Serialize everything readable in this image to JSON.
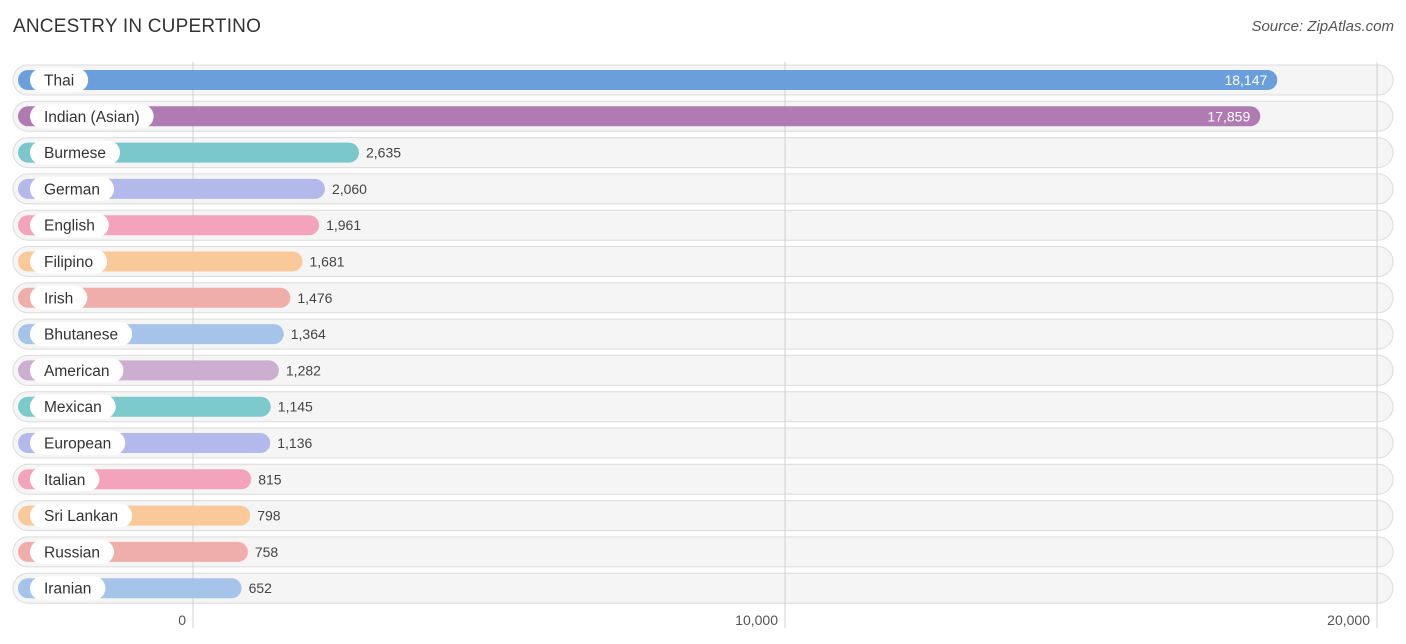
{
  "header": {
    "title": "ANCESTRY IN CUPERTINO",
    "source": "Source: ZipAtlas.com"
  },
  "chart_data": {
    "type": "bar",
    "orientation": "horizontal",
    "title": "ANCESTRY IN CUPERTINO",
    "xlabel": "",
    "ylabel": "",
    "xlim": [
      0,
      20000
    ],
    "x_ticks": [
      0,
      10000,
      20000
    ],
    "x_tick_labels": [
      "0",
      "10,000",
      "20,000"
    ],
    "grid": true,
    "categories": [
      "Thai",
      "Indian (Asian)",
      "Burmese",
      "German",
      "English",
      "Filipino",
      "Irish",
      "Bhutanese",
      "American",
      "Mexican",
      "European",
      "Italian",
      "Sri Lankan",
      "Russian",
      "Iranian"
    ],
    "values": [
      18147,
      17859,
      2635,
      2060,
      1961,
      1681,
      1476,
      1364,
      1282,
      1145,
      1136,
      815,
      798,
      758,
      652
    ],
    "value_labels": [
      "18,147",
      "17,859",
      "2,635",
      "2,060",
      "1,961",
      "1,681",
      "1,476",
      "1,364",
      "1,282",
      "1,145",
      "1,136",
      "815",
      "798",
      "758",
      "652"
    ],
    "colors": [
      "#6a9fdc",
      "#b07ab3",
      "#7ac8cc",
      "#b3b9ea",
      "#f4a3bd",
      "#f9c99a",
      "#efaeaa",
      "#a6c4ea",
      "#ccaed0",
      "#7dcacd",
      "#b3b9ea",
      "#f4a3bd",
      "#f9c99a",
      "#efaeaa",
      "#a6c4ea"
    ]
  }
}
